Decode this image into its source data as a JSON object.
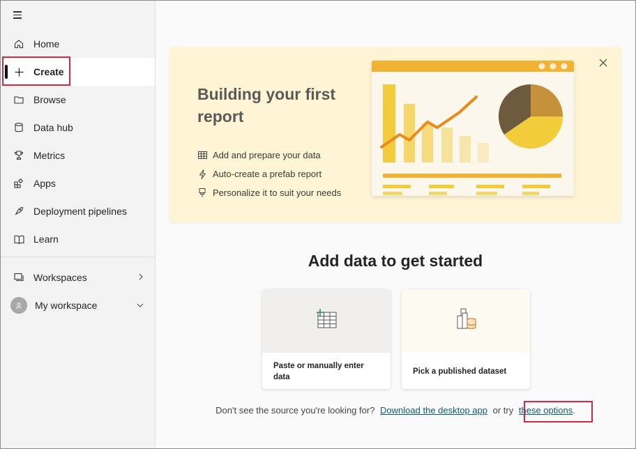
{
  "sidebar": {
    "items": [
      {
        "label": "Home",
        "icon": "home-icon"
      },
      {
        "label": "Create",
        "icon": "plus-icon"
      },
      {
        "label": "Browse",
        "icon": "folder-icon"
      },
      {
        "label": "Data hub",
        "icon": "database-icon"
      },
      {
        "label": "Metrics",
        "icon": "trophy-icon"
      },
      {
        "label": "Apps",
        "icon": "apps-icon"
      },
      {
        "label": "Deployment pipelines",
        "icon": "rocket-icon"
      },
      {
        "label": "Learn",
        "icon": "book-icon"
      }
    ],
    "workspaces_label": "Workspaces",
    "my_workspace_label": "My workspace"
  },
  "banner": {
    "title": "Building your first report",
    "features": [
      {
        "text": "Add and prepare your data",
        "icon": "table-icon"
      },
      {
        "text": "Auto-create a prefab report",
        "icon": "lightning-icon"
      },
      {
        "text": "Personalize it to suit your needs",
        "icon": "paintbrush-icon"
      }
    ]
  },
  "main": {
    "heading": "Add data to get started",
    "cards": [
      {
        "label": "Paste or manually enter data",
        "icon": "table-add-icon"
      },
      {
        "label": "Pick a published dataset",
        "icon": "dataset-icon"
      }
    ],
    "footer_text": "Don't see the source you're looking for?",
    "footer_link1": "Download the desktop app",
    "footer_or": "or try",
    "footer_link2": "these options",
    "footer_end": "."
  },
  "colors": {
    "accent_yellow": "#f2c811",
    "highlight": "#d7263d",
    "link": "#0f5c6e"
  }
}
